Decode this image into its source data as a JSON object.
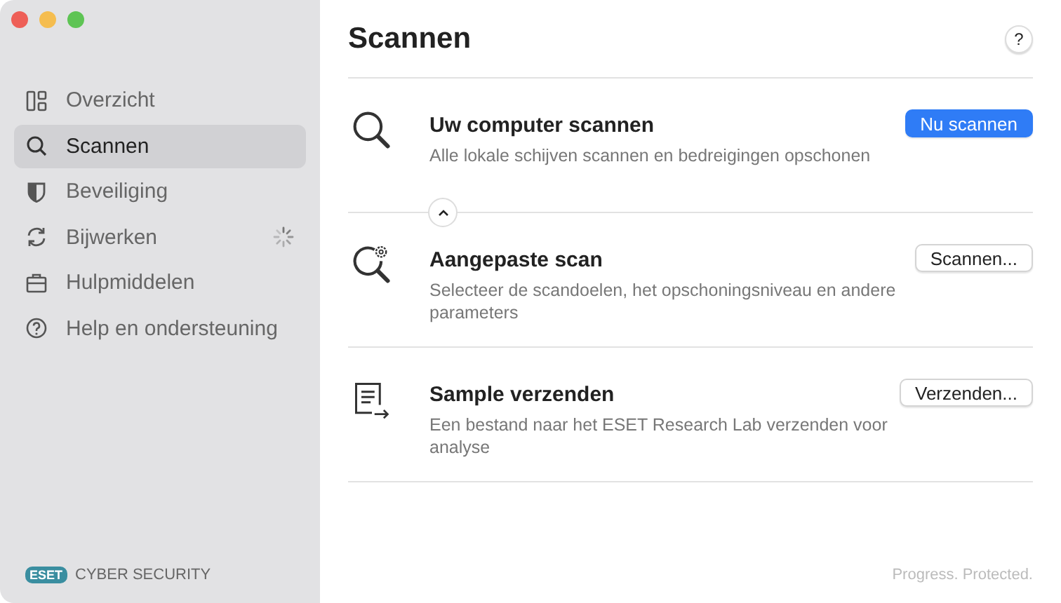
{
  "sidebar": {
    "items": [
      {
        "kind": "overview",
        "label": "Overzicht",
        "selected": false,
        "busy": false
      },
      {
        "kind": "search",
        "label": "Scannen",
        "selected": true,
        "busy": false
      },
      {
        "kind": "shield",
        "label": "Beveiliging",
        "selected": false,
        "busy": false
      },
      {
        "kind": "refresh",
        "label": "Bijwerken",
        "selected": false,
        "busy": true
      },
      {
        "kind": "toolbox",
        "label": "Hulpmiddelen",
        "selected": false,
        "busy": false
      },
      {
        "kind": "help",
        "label": "Help en ondersteuning",
        "selected": false,
        "busy": false
      }
    ],
    "brand": {
      "logo": "ESET",
      "product": "CYBER SECURITY"
    }
  },
  "page": {
    "title": "Scannen",
    "help": "?"
  },
  "sections": [
    {
      "kind": "search",
      "title": "Uw computer scannen",
      "description": "Alle lokale schijven scannen en bedreigingen opschonen",
      "button": "Nu scannen",
      "primary": true,
      "toggle": {
        "expanded": true
      }
    },
    {
      "kind": "custom-scan",
      "title": "Aangepaste scan",
      "description": "Selecteer de scandoelen, het opschoningsniveau en andere parameters",
      "button": "Scannen...",
      "primary": false
    },
    {
      "kind": "document",
      "title": "Sample verzenden",
      "description": "Een bestand naar het ESET Research Lab verzenden voor analyse",
      "button": "Verzenden...",
      "primary": false
    }
  ],
  "footer": {
    "tagline": "Progress. Protected."
  }
}
